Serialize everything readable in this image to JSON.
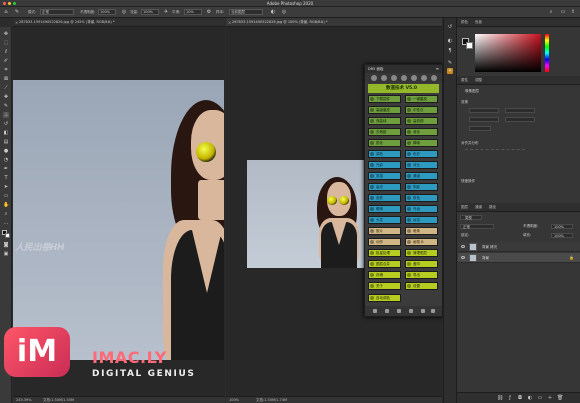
{
  "app": {
    "title": "Adobe Photoshop 2020"
  },
  "options_bar": {
    "mode_label": "模式:",
    "mode_value": "正常",
    "opacity_label": "不透明度:",
    "opacity_value": "100%",
    "flow_label": "流量:",
    "flow_value": "100%",
    "smoothing_label": "平滑:",
    "smoothing_value": "10%",
    "sample_label": "样本:",
    "sample_value": "当前图层"
  },
  "doc1": {
    "tab": "287833-1591490522826.jpg @ 245% (背景, RGB/8#) *",
    "zoom": "245.39%",
    "doc_size": "文档:1.50M/1.50M",
    "watermark": "人民出卷HH"
  },
  "doc2": {
    "tab": "287833-1591490522826.jpg @ 100% (背景, RGB/8#) *",
    "zoom": "100%",
    "doc_size": "文档:1.50M/1.74M"
  },
  "plugin": {
    "header": "DR5 面板",
    "title": "数道技术 V5.0",
    "buttons": [
      {
        "left": "下载插件",
        "right": "一键磨皮",
        "color": "g"
      },
      {
        "left": "高级磨皮",
        "right": "中性灰",
        "color": "g"
      },
      {
        "left": "双曲线",
        "right": "高低频",
        "color": "g"
      },
      {
        "left": "去瑕疵",
        "right": "液化",
        "color": "g"
      },
      {
        "left": "锐化",
        "right": "降噪",
        "color": "g"
      },
      {
        "left": "调色",
        "right": "色彩",
        "color": "t"
      },
      {
        "left": "光影",
        "right": "对比",
        "color": "t"
      },
      {
        "left": "质感",
        "right": "通道",
        "color": "t"
      },
      {
        "left": "高光",
        "right": "阴影",
        "color": "t"
      },
      {
        "left": "皮肤",
        "right": "肤色",
        "color": "t"
      },
      {
        "left": "眼睛",
        "right": "牙齿",
        "color": "t"
      },
      {
        "left": "头发",
        "right": "妆容",
        "color": "t"
      },
      {
        "left": "胶片",
        "right": "暗角",
        "color": "b"
      },
      {
        "left": "动作",
        "right": "画笔 B",
        "color": "b"
      },
      {
        "left": "批量处理",
        "right": "清理图层",
        "color": "y"
      },
      {
        "left": "图层合并",
        "right": "盖印",
        "color": "y"
      },
      {
        "left": "存储",
        "right": "导出",
        "color": "y"
      },
      {
        "left": "关于",
        "right": "设置",
        "color": "y"
      }
    ],
    "last_button": "自动调色"
  },
  "panels": {
    "color_tabs": [
      "颜色",
      "色板"
    ],
    "properties_tabs": [
      "属性",
      "调整"
    ],
    "properties_title": "像素图层",
    "transform_label": "变换",
    "align_label": "对齐并分布",
    "quick_actions_label": "快速操作",
    "layer_tabs": [
      "图层",
      "通道",
      "路径"
    ],
    "filter_label": "类型",
    "blend_mode": "正常",
    "opacity_label": "不透明度:",
    "opacity_value": "100%",
    "lock_label": "锁定:",
    "fill_label": "填充:",
    "fill_value": "100%",
    "layers": [
      {
        "name": "背景 拷贝"
      },
      {
        "name": "背景"
      }
    ]
  },
  "watermark_logo": {
    "mark": "iM",
    "name": "IMAC.LY",
    "tagline": "DIGITAL GENIUS"
  },
  "colors": {
    "accent_pink": "#ff5668",
    "plugin_green": "#6f9e3c",
    "plugin_teal": "#2f9ac0",
    "plugin_lime": "#b6cc20"
  }
}
